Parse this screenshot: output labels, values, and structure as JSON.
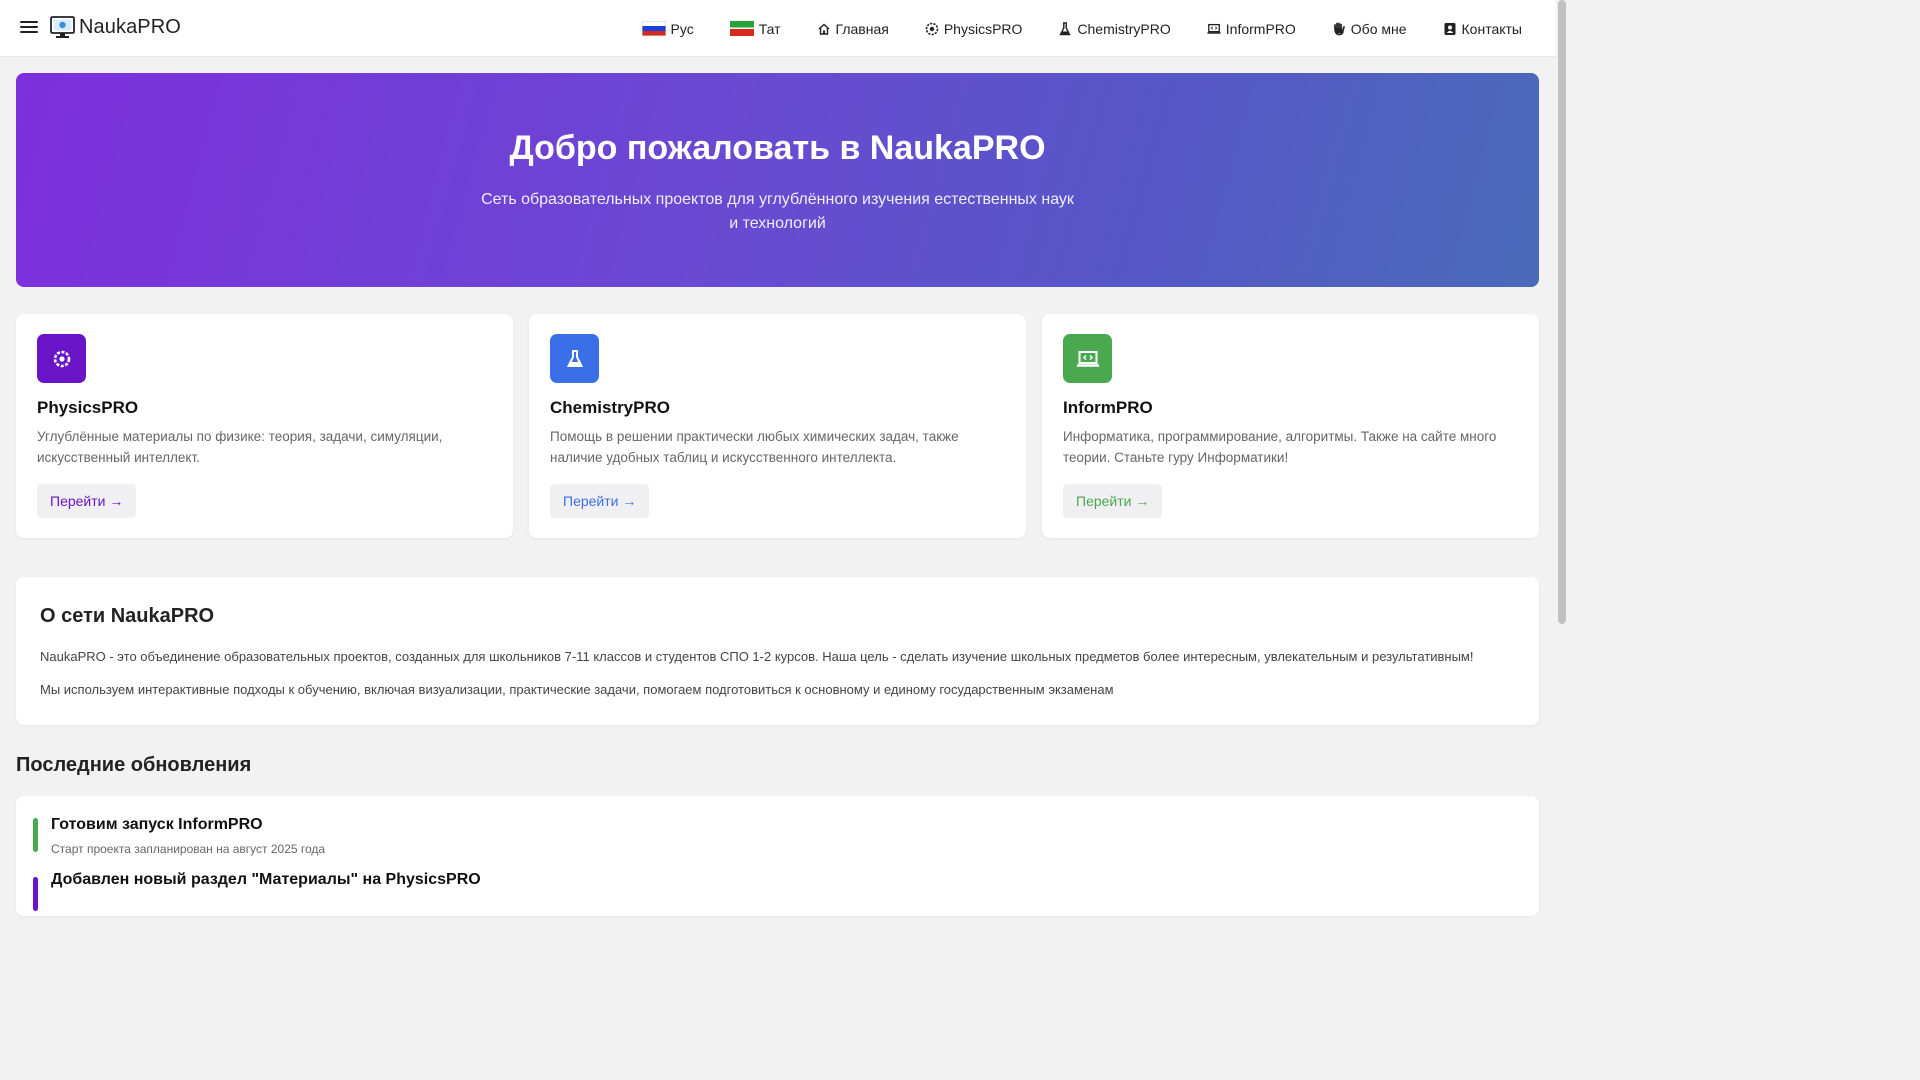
{
  "header": {
    "logo_text": "NaukaPRO",
    "nav": [
      {
        "label": "Рус",
        "icon": "flag-ru"
      },
      {
        "label": "Тат",
        "icon": "flag-tt"
      },
      {
        "label": "Главная",
        "icon": "home-icon"
      },
      {
        "label": "PhysicsPRO",
        "icon": "atom-icon"
      },
      {
        "label": "ChemistryPRO",
        "icon": "flask-icon"
      },
      {
        "label": "InformPRO",
        "icon": "laptop-code-icon"
      },
      {
        "label": "Обо мне",
        "icon": "hand-icon"
      },
      {
        "label": "Контакты",
        "icon": "contact-icon"
      }
    ]
  },
  "hero": {
    "title": "Добро пожаловать в NaukaPRO",
    "subtitle": "Сеть образовательных проектов для углублённого изучения естественных наук и технологий"
  },
  "cards": [
    {
      "title": "PhysicsPRO",
      "text": "Углублённые материалы по физике: теория, задачи, симуляции, искусственный интеллект.",
      "button": "Перейти →",
      "color": "#6a14c8",
      "icon": "atom-icon"
    },
    {
      "title": "ChemistryPRO",
      "text": "Помощь в решении практически любых химических задач, также наличие удобных таблиц и искусственного интеллекта.",
      "button": "Перейти →",
      "color": "#3b6fe8",
      "icon": "flask-icon"
    },
    {
      "title": "InformPRO",
      "text": "Информатика, программирование, алгоритмы. Также на сайте много теории. Станьте гуру Информатики!",
      "button": "Перейти →",
      "color": "#4aa84f",
      "icon": "laptop-code-icon"
    }
  ],
  "about": {
    "title": "О сети NaukaPRO",
    "p1": "NaukaPRO - это объединение образовательных проектов, созданных для школьников 7-11 классов и студентов СПО 1-2 курсов. Наша цель - сделать изучение школьных предметов более интересным, увлекательным и результативным!",
    "p2": "Мы используем интерактивные подходы к обучению, включая визуализации, практические задачи, помогаем подготовиться к основному и единому государственным экзаменам"
  },
  "updates": {
    "title": "Последние обновления",
    "items": [
      {
        "title": "Готовим запуск InformPRO",
        "subtitle": "Старт проекта запланирован на август 2025 года",
        "color": "#4aa84f"
      },
      {
        "title": "Добавлен новый раздел \"Материалы\" на PhysicsPRO",
        "subtitle": "",
        "color": "#6a14c8"
      }
    ]
  }
}
